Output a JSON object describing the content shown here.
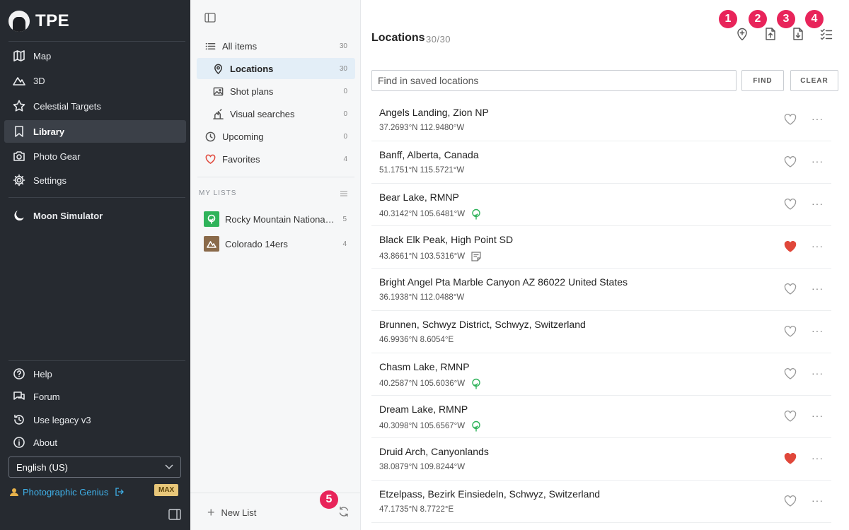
{
  "sidebar": {
    "brand": "TPE",
    "nav": [
      {
        "label": "Map",
        "icon": "map-icon",
        "active": false
      },
      {
        "label": "3D",
        "icon": "mountain-icon",
        "active": false
      },
      {
        "label": "Celestial Targets",
        "icon": "star-icon",
        "active": false
      },
      {
        "label": "Library",
        "icon": "bookmark-icon",
        "active": true
      },
      {
        "label": "Photo Gear",
        "icon": "camera-icon",
        "active": false
      },
      {
        "label": "Settings",
        "icon": "gear-icon",
        "active": false
      }
    ],
    "moon": {
      "label": "Moon Simulator",
      "icon": "moon-icon"
    },
    "bottom_nav": [
      {
        "label": "Help",
        "icon": "help-icon"
      },
      {
        "label": "Forum",
        "icon": "forum-icon"
      },
      {
        "label": "Use legacy v3",
        "icon": "history-icon"
      },
      {
        "label": "About",
        "icon": "info-icon"
      }
    ],
    "language": "English (US)",
    "user": {
      "name": "Photographic Genius",
      "plan_badge": "MAX"
    }
  },
  "middle": {
    "items": [
      {
        "label": "All items",
        "count": "30",
        "icon": "list-icon",
        "sub": false,
        "active": false
      },
      {
        "label": "Locations",
        "count": "30",
        "icon": "pin-icon",
        "sub": true,
        "active": true
      },
      {
        "label": "Shot plans",
        "count": "0",
        "icon": "image-icon",
        "sub": true,
        "active": false
      },
      {
        "label": "Visual searches",
        "count": "0",
        "icon": "visual-search-icon",
        "sub": true,
        "active": false
      },
      {
        "label": "Upcoming",
        "count": "0",
        "icon": "clock-icon",
        "sub": false,
        "active": false
      },
      {
        "label": "Favorites",
        "count": "4",
        "icon": "heart-icon",
        "sub": false,
        "active": false
      }
    ],
    "my_lists_header": "MY LISTS",
    "lists": [
      {
        "label": "Rocky Mountain National Park",
        "count": "5",
        "color": "#2fb35a",
        "icon": "tree-icon"
      },
      {
        "label": "Colorado 14ers",
        "count": "4",
        "color": "#8a6a4a",
        "icon": "mountain-icon"
      }
    ],
    "new_list_label": "New List"
  },
  "callouts": [
    "1",
    "2",
    "3",
    "4",
    "5"
  ],
  "main": {
    "title": "Locations",
    "count": "30/30",
    "search_placeholder": "Find in saved locations",
    "find_label": "FIND",
    "clear_label": "CLEAR",
    "locations": [
      {
        "name": "Angels Landing, Zion NP",
        "coords": "37.2693°N 112.9480°W",
        "favorite": false,
        "extra": ""
      },
      {
        "name": "Banff, Alberta, Canada",
        "coords": "51.1751°N 115.5721°W",
        "favorite": false,
        "extra": ""
      },
      {
        "name": "Bear Lake, RMNP",
        "coords": "40.3142°N 105.6481°W",
        "favorite": false,
        "extra": "tree-icon"
      },
      {
        "name": "Black Elk Peak, High Point SD",
        "coords": "43.8661°N 103.5316°W",
        "favorite": true,
        "extra": "note-icon"
      },
      {
        "name": "Bright Angel Pta Marble Canyon AZ 86022 United States",
        "coords": "36.1938°N 112.0488°W",
        "favorite": false,
        "extra": ""
      },
      {
        "name": "Brunnen, Schwyz District, Schwyz, Switzerland",
        "coords": "46.9936°N 8.6054°E",
        "favorite": false,
        "extra": ""
      },
      {
        "name": "Chasm Lake, RMNP",
        "coords": "40.2587°N 105.6036°W",
        "favorite": false,
        "extra": "tree-icon"
      },
      {
        "name": "Dream Lake, RMNP",
        "coords": "40.3098°N 105.6567°W",
        "favorite": false,
        "extra": "tree-icon"
      },
      {
        "name": "Druid Arch, Canyonlands",
        "coords": "38.0879°N 109.8244°W",
        "favorite": true,
        "extra": ""
      },
      {
        "name": "Etzelpass, Bezirk Einsiedeln, Schwyz, Switzerland",
        "coords": "47.1735°N 8.7722°E",
        "favorite": false,
        "extra": ""
      }
    ]
  },
  "colors": {
    "sidebar_bg": "#262a30",
    "accent_red": "#e8245a",
    "favorite_red": "#e0473a",
    "tree_green": "#2fb35a",
    "user_link": "#3fb0e8"
  }
}
